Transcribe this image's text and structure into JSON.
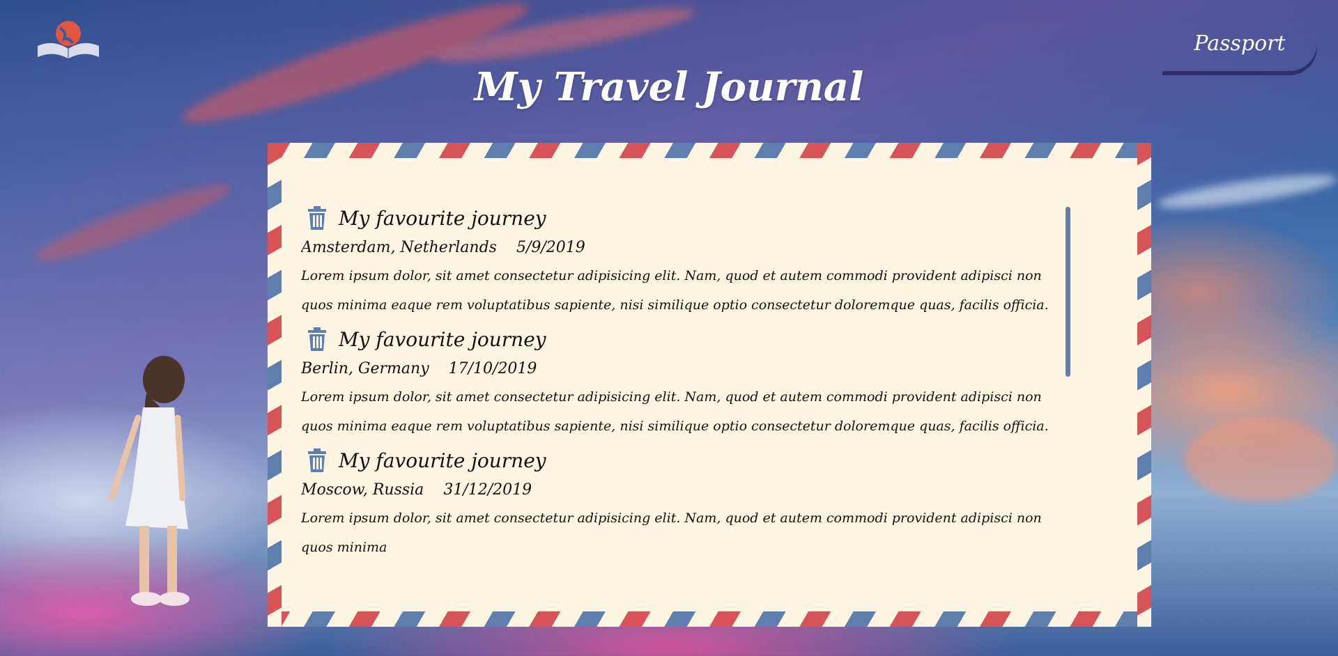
{
  "header": {
    "logo_icon": "open-book-globe-icon",
    "passport_label": "Passport",
    "title": "My Travel Journal"
  },
  "colors": {
    "envelope_bg": "#fdf5e1",
    "stripe_red": "#d65457",
    "stripe_blue": "#5e7fae",
    "trash_icon": "#5e7fae"
  },
  "entries": [
    {
      "title": "My favourite journey",
      "location": "Amsterdam, Netherlands",
      "date": "5/9/2019",
      "description": "Lorem ipsum dolor, sit amet consectetur adipisicing elit. Nam, quod et autem commodi provident adipisci non quos minima eaque rem voluptatibus sapiente, nisi similique optio consectetur doloremque quas, facilis officia.",
      "icon": "trash-icon"
    },
    {
      "title": "My favourite journey",
      "location": "Berlin, Germany",
      "date": "17/10/2019",
      "description": "Lorem ipsum dolor, sit amet consectetur adipisicing elit. Nam, quod et autem commodi provident adipisci non quos minima eaque rem voluptatibus sapiente, nisi similique optio consectetur doloremque quas, facilis officia.",
      "icon": "trash-icon"
    },
    {
      "title": "My favourite journey",
      "location": "Moscow, Russia",
      "date": "31/12/2019",
      "description": "Lorem ipsum dolor, sit amet consectetur adipisicing elit. Nam, quod et autem commodi provident adipisci non quos minima",
      "icon": "trash-icon"
    }
  ]
}
